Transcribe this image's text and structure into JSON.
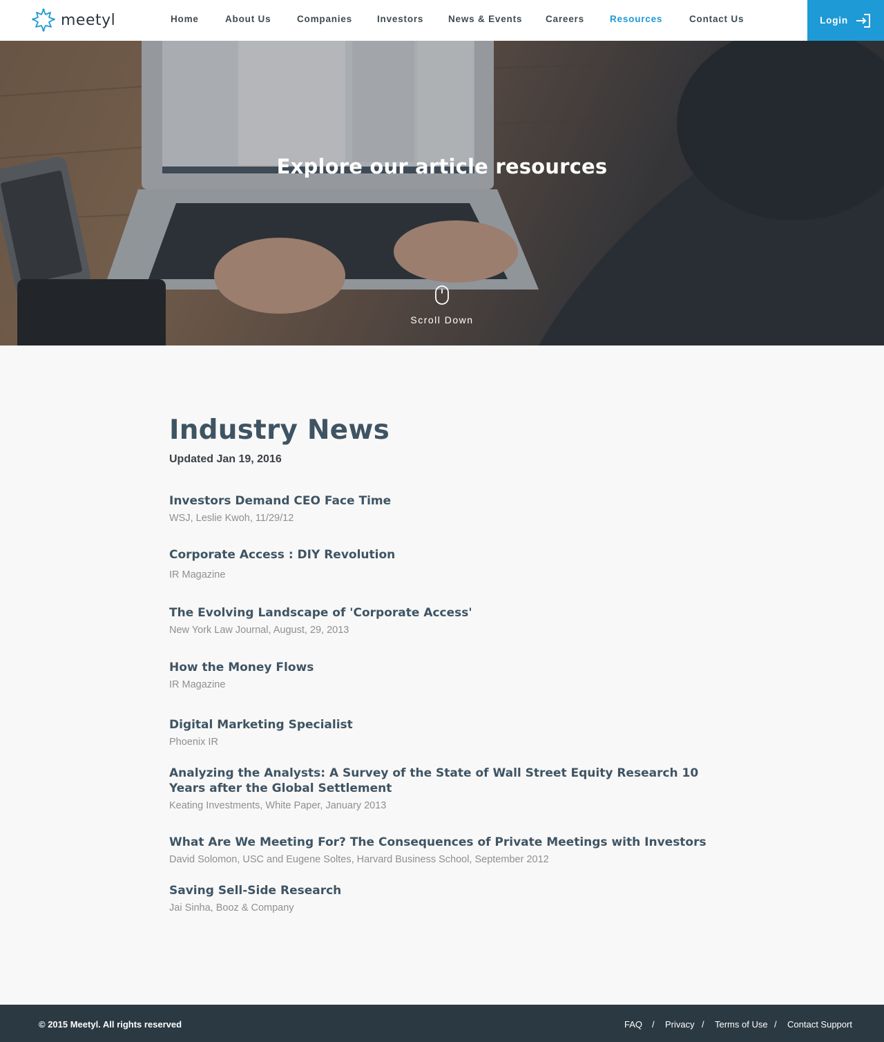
{
  "header": {
    "logo_text": "meetyl",
    "nav": [
      {
        "label": "Home",
        "active": false
      },
      {
        "label": "About Us",
        "active": false
      },
      {
        "label": "Companies",
        "active": false
      },
      {
        "label": "Investors",
        "active": false
      },
      {
        "label": "News & Events",
        "active": false
      },
      {
        "label": "Careers",
        "active": false
      },
      {
        "label": "Resources",
        "active": true
      },
      {
        "label": "Contact Us",
        "active": false
      }
    ],
    "login_label": "Login"
  },
  "hero": {
    "title": "Explore our article resources",
    "scroll_label": "Scroll Down"
  },
  "main": {
    "title": "Industry News",
    "updated": "Updated Jan 19, 2016",
    "articles": [
      {
        "title": "Investors Demand CEO Face Time",
        "source": "WSJ, Leslie Kwoh, 11/29/12"
      },
      {
        "title": "Corporate Access : DIY Revolution",
        "source": "IR Magazine"
      },
      {
        "title": "The Evolving Landscape of 'Corporate Access'",
        "source": "New York Law Journal, August, 29, 2013"
      },
      {
        "title": "How the Money Flows",
        "source": "IR Magazine"
      },
      {
        "title": "Digital Marketing Specialist",
        "source": "Phoenix IR"
      },
      {
        "title": "Analyzing the Analysts: A Survey of the State of Wall Street Equity Research 10 Years after the Global Settlement",
        "source": "Keating Investments, White Paper, January 2013"
      },
      {
        "title": "What Are We Meeting For? The Consequences of Private Meetings with Investors",
        "source": "David Solomon, USC and Eugene Soltes, Harvard Business School, September 2012"
      },
      {
        "title": "Saving Sell-Side Research",
        "source": "Jai Sinha, Booz & Company"
      }
    ]
  },
  "footer": {
    "copyright": "© 2015 Meetyl. All rights reserved",
    "links": [
      "FAQ",
      "Privacy",
      "Terms of Use",
      "Contact Support"
    ],
    "separator": "/"
  },
  "colors": {
    "accent": "#1e9ad6",
    "heading": "#3f5463",
    "footer_bg": "#2b3942",
    "page_bg": "#f8f8f8"
  }
}
